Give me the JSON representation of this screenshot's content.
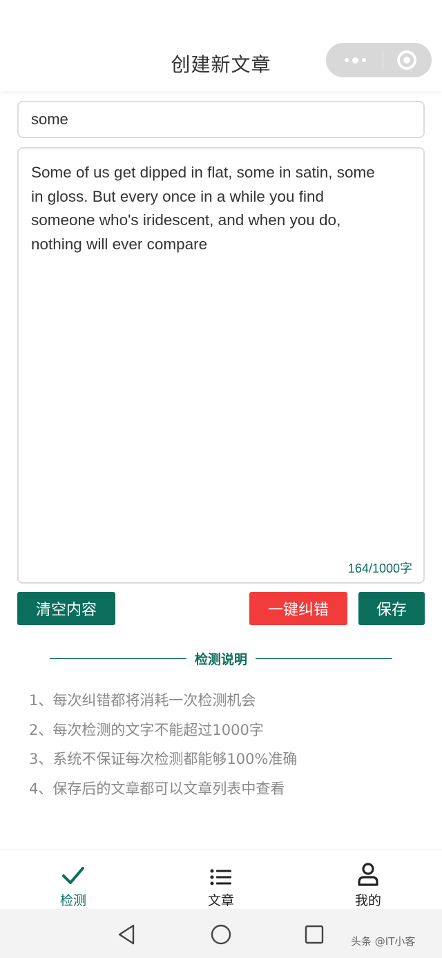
{
  "header": {
    "title": "创建新文章"
  },
  "editor": {
    "title_value": "some",
    "content_value": "Some of us get dipped in flat, some in satin, some\nin gloss. But every once in a while you find\nsomeone who's iridescent, and when you do,\nnothing will ever compare",
    "char_count": "164/1000字"
  },
  "actions": {
    "clear_label": "清空内容",
    "correct_label": "一键纠错",
    "save_label": "保存"
  },
  "instructions": {
    "heading": "检测说明",
    "items": [
      "1、每次纠错都将消耗一次检测机会",
      "2、每次检测的文字不能超过1000字",
      "3、系统不保证每次检测都能够100%准确",
      "4、保存后的文章都可以文章列表中查看"
    ]
  },
  "tabbar": {
    "items": [
      {
        "label": "检测",
        "icon": "check-icon",
        "active": true
      },
      {
        "label": "文章",
        "icon": "list-icon",
        "active": false
      },
      {
        "label": "我的",
        "icon": "user-icon",
        "active": false
      }
    ]
  },
  "colors": {
    "primary": "#0b6e5c",
    "danger": "#f23b3b",
    "muted": "#8a8a8a"
  },
  "watermark": "头条 @IT小客"
}
